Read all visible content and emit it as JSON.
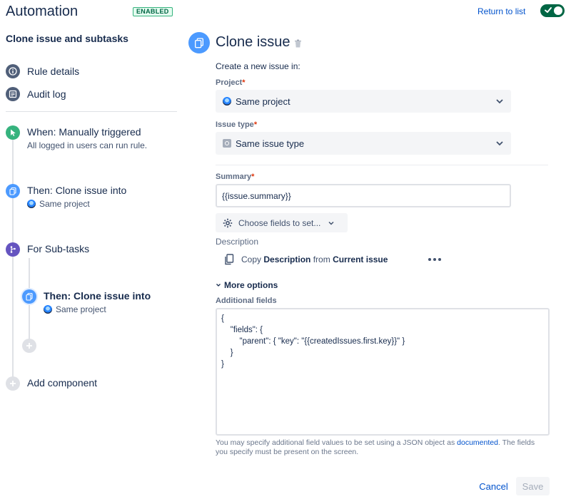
{
  "header": {
    "app_title": "Automation",
    "status_badge": "ENABLED",
    "return_link": "Return to list",
    "toggle_on": true
  },
  "sidebar": {
    "rule_name": "Clone issue and subtasks",
    "links": [
      {
        "label": "Rule details",
        "icon": "info-icon"
      },
      {
        "label": "Audit log",
        "icon": "list-icon"
      }
    ],
    "steps": [
      {
        "title": "When: Manually triggered",
        "sub": "All logged in users can run rule.",
        "icon": "cursor-icon",
        "color": "#36b37e"
      },
      {
        "title": "Then: Clone issue into",
        "sub": "Same project",
        "icon": "clone-icon",
        "color": "#4c9aff"
      },
      {
        "title": "For Sub-tasks",
        "icon": "branch-icon",
        "color": "#6554c0"
      },
      {
        "title": "Then: Clone issue into",
        "sub": "Same project",
        "icon": "clone-icon",
        "color": "#4c9aff",
        "selected": true
      }
    ],
    "add_component": "Add component"
  },
  "main": {
    "title": "Clone issue",
    "create_in": "Create a new issue in:",
    "project": {
      "label": "Project",
      "required": "*",
      "value": "Same project"
    },
    "issue_type": {
      "label": "Issue type",
      "required": "*",
      "value": "Same issue type"
    },
    "summary": {
      "label": "Summary",
      "required": "*",
      "value": "{{issue.summary}}"
    },
    "choose_fields": "Choose fields to set...",
    "description": {
      "label": "Description",
      "copy_prefix": "Copy",
      "copy_field": "Description",
      "copy_mid": "from",
      "copy_source": "Current issue"
    },
    "more_options": "More options",
    "additional_fields": {
      "label": "Additional fields",
      "value": "{\n    \"fields\": {\n        \"parent\": { \"key\": \"{{createdIssues.first.key}}\" }\n    }\n}"
    },
    "help": {
      "text_before": "You may specify additional field values to be set using a JSON object as ",
      "link": "documented",
      "text_after": ". The fields you specify must be present on the screen."
    },
    "cancel": "Cancel",
    "save": "Save"
  },
  "colors": {
    "accent": "#0052cc",
    "toggle": "#006644",
    "required": "#de350b"
  }
}
